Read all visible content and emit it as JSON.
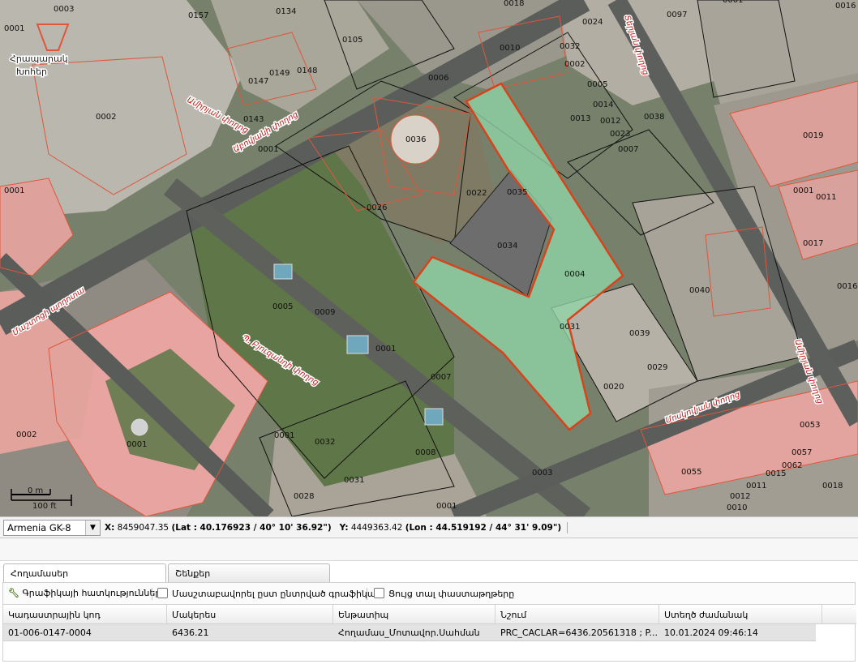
{
  "map": {
    "scale_bar": {
      "top_label": "0 m",
      "bottom_label": "100 ft"
    },
    "poi_label_line1": "Հրապարակ",
    "poi_label_line2": "Խոհեր",
    "selected_parcel_label": "0004",
    "parcel_labels": [
      "0034",
      "0035",
      "0036",
      "0022",
      "0026",
      "0006",
      "0010",
      "0024",
      "0002",
      "0032",
      "0005",
      "0014",
      "0013",
      "0012",
      "0023",
      "0007",
      "0038",
      "0097",
      "0018",
      "0001",
      "0157",
      "0134",
      "0105",
      "0147",
      "0149",
      "0148",
      "0143",
      "0002",
      "0001",
      "0003",
      "0001",
      "0005",
      "0009",
      "0001",
      "0007",
      "0008",
      "0003",
      "0001",
      "0032",
      "0031",
      "0028",
      "0001",
      "0002",
      "0001",
      "0040",
      "0019",
      "0011",
      "0017",
      "0016",
      "0001",
      "0031",
      "0039",
      "0029",
      "0020",
      "0053",
      "0055",
      "0057",
      "0062",
      "0015",
      "0011",
      "0012",
      "0010",
      "0018",
      "0001",
      "0016"
    ],
    "street_labels": [
      "Մաշտոցի պողոտա",
      "Աբովյանի փողոց",
      "Պ. Բյուզանդի փողոց",
      "Ամիրյան փողոց",
      "Տերյան փողոց",
      "Մոսկովյան փողոց",
      "Ամիրյան փողոց"
    ]
  },
  "coordbar": {
    "projection": "Armenia GK-8",
    "x_label": "X:",
    "x_value": "8459047.35",
    "x_latlon": "(Lat : 40.176923 / 40° 10' 36.92\")",
    "y_label": "Y:",
    "y_value": "4449363.42",
    "y_latlon": "(Lon : 44.519192 / 44° 31' 9.09\")"
  },
  "tabs": [
    {
      "label": "Հողամասեր",
      "active": true
    },
    {
      "label": "Շենքեր",
      "active": false
    }
  ],
  "toolbar": {
    "graphics_props": "Գրաֆիկայի հատկություններ",
    "zoom_to_selected": "Մասշտաբավորել ըստ ընտրված գրաֆիկայի",
    "show_docs": "Ցույց տալ փաստաթղթերը"
  },
  "grid": {
    "headers": [
      "Կադաստրային կոդ",
      "Մակերես",
      "Ենթատիպ",
      "Նշում",
      "Ստեղծ ժամանակ"
    ],
    "rows": [
      [
        "01-006-0147-0004",
        "6436.21",
        "Հողամաս_Մոտավոր.Սահման",
        "PRC_CACLAR=6436.20561318 ; P...",
        "10.01.2024 09:46:14"
      ]
    ]
  },
  "colors": {
    "parcel_outline": "#e0563b",
    "selected_fill": "#8fd5a6",
    "selected_stroke": "#d8431c",
    "building_pink": "#e7a4a0",
    "street_label": "#c01818"
  }
}
